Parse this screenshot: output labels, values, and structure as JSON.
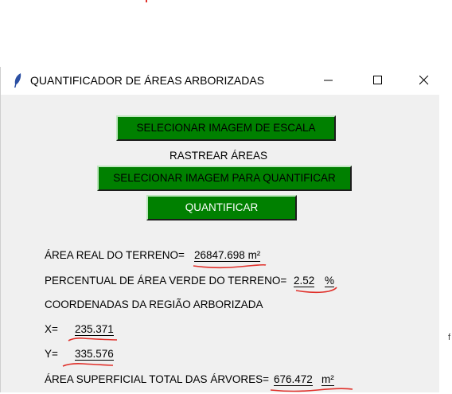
{
  "window": {
    "title": "QUANTIFICADOR DE ÁREAS ARBORIZADAS"
  },
  "buttons": {
    "select_scale": "SELECIONAR IMAGEM DE ESCALA",
    "track_label": "RASTREAR ÁREAS",
    "select_quantify": "SELECIONAR IMAGEM PARA QUANTIFICAR",
    "quantify": "QUANTIFICAR"
  },
  "results": {
    "real_area_label": "ÁREA REAL DO TERRENO=",
    "real_area_value": "26847.698 m²",
    "green_pct_label": "PERCENTUAL DE ÁREA VERDE DO TERRENO=",
    "green_pct_value": "2.52",
    "green_pct_unit": "%",
    "coords_label": "COORDENADAS DA REGIÃO ARBORIZADA",
    "x_label": "X=",
    "x_value": "235.371",
    "y_label": "Y=",
    "y_value": "335.576",
    "tree_area_label": "ÁREA SUPERFICIAL TOTAL DAS ÁRVORES=",
    "tree_area_value": "676.472",
    "tree_area_unit": "m²"
  },
  "stray_text": "f",
  "colors": {
    "button_green": "#008000",
    "annotation_red": "#e0302a"
  },
  "icons": [
    "feather-icon",
    "minimize-icon",
    "maximize-icon",
    "close-icon"
  ]
}
